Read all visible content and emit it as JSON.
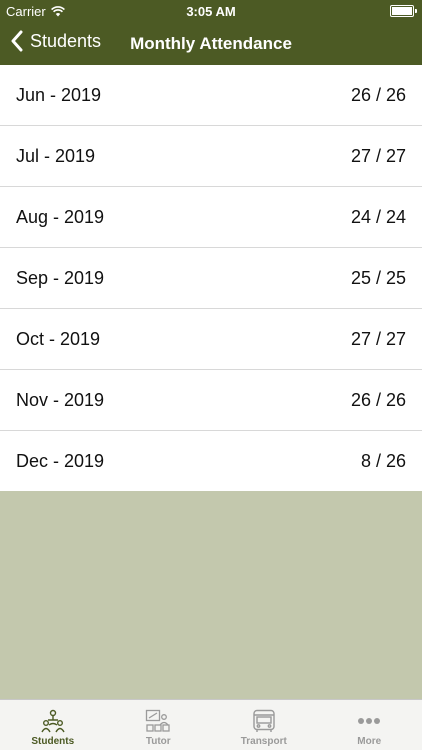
{
  "status_bar": {
    "carrier": "Carrier",
    "time": "3:05 AM"
  },
  "nav": {
    "back_label": "Students",
    "title": "Monthly Attendance"
  },
  "months": [
    {
      "month": "Jun - 2019",
      "attendance": "26 / 26"
    },
    {
      "month": "Jul - 2019",
      "attendance": "27 / 27"
    },
    {
      "month": "Aug - 2019",
      "attendance": "24 / 24"
    },
    {
      "month": "Sep - 2019",
      "attendance": "25 / 25"
    },
    {
      "month": "Oct - 2019",
      "attendance": "27 / 27"
    },
    {
      "month": "Nov - 2019",
      "attendance": "26 / 26"
    },
    {
      "month": "Dec - 2019",
      "attendance": "8 / 26"
    }
  ],
  "tabs": [
    {
      "label": "Students",
      "icon": "students-icon",
      "active": true
    },
    {
      "label": "Tutor",
      "icon": "tutor-icon"
    },
    {
      "label": "Transport",
      "icon": "bus-icon"
    },
    {
      "label": "More",
      "icon": "more-icon"
    }
  ],
  "colors": {
    "header": "#4c5a24",
    "background": "#c3c8ad",
    "tab_active": "#4c5a24",
    "tab_inactive": "#9a9a9a"
  }
}
